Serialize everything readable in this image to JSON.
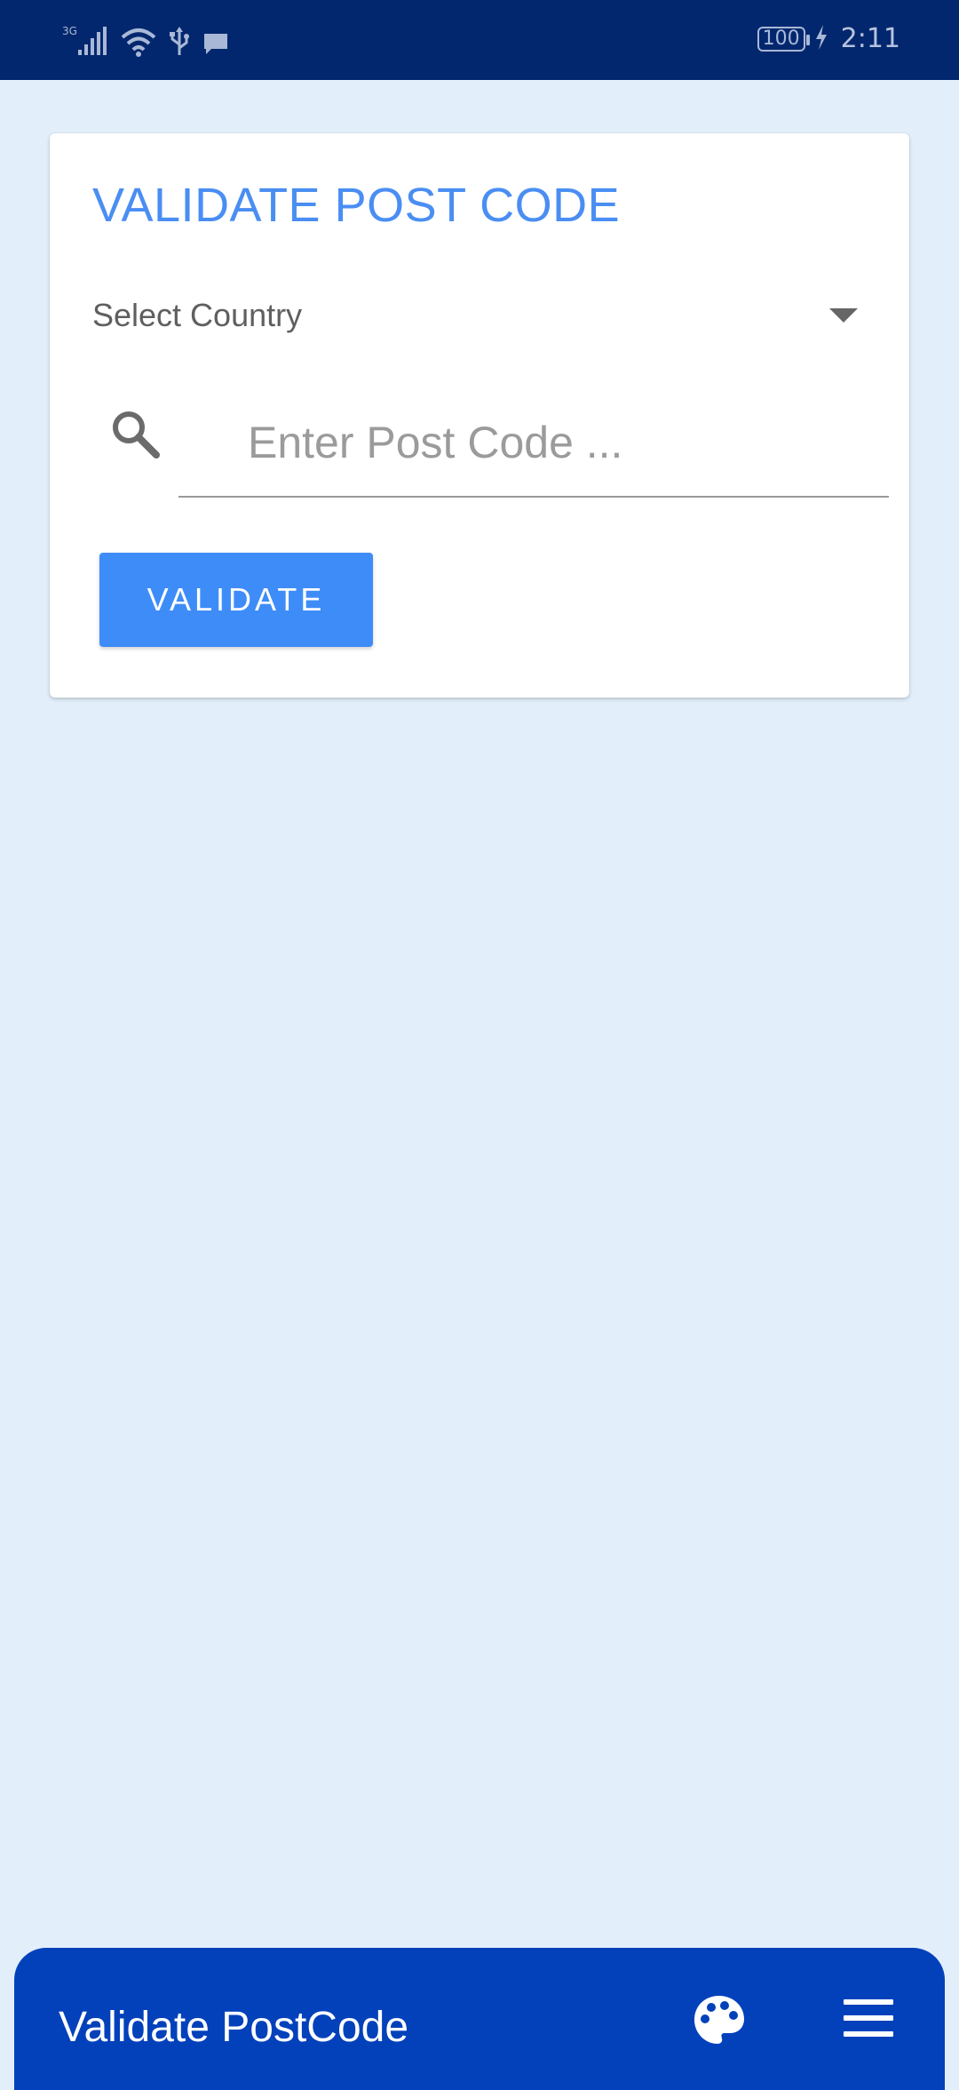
{
  "status_bar": {
    "network": "3G",
    "battery": "100",
    "time": "2:11"
  },
  "card": {
    "title": "VALIDATE POST CODE",
    "country_select": {
      "label": "Select Country"
    },
    "postcode_input": {
      "placeholder": "Enter Post Code ...",
      "value": ""
    },
    "validate_button_label": "VALIDATE"
  },
  "bottom_bar": {
    "title": "Validate PostCode",
    "icons": [
      "palette-icon",
      "menu-icon"
    ]
  },
  "colors": {
    "status_bar": "#02276e",
    "background": "#e2effb",
    "accent": "#4a8ef3",
    "button": "#3e8cf8",
    "bottom_bar": "#0341bb"
  }
}
